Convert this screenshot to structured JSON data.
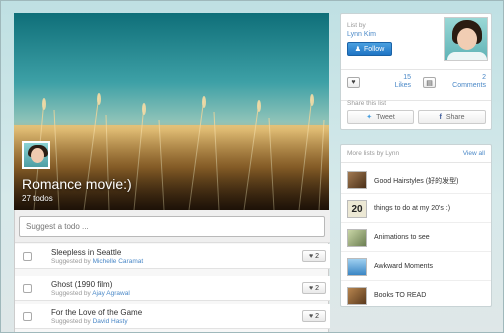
{
  "hero": {
    "title": "Romance movie:)",
    "count": "27 todos"
  },
  "suggest": {
    "placeholder": "Suggest a todo ..."
  },
  "todos": [
    {
      "title": "Sleepless in Seattle",
      "suggested_prefix": "Suggested by",
      "suggested_by": "Michelle Caramat",
      "likes": "2"
    },
    {
      "title": "Ghost (1990 film)",
      "suggested_prefix": "Suggested by",
      "suggested_by": "Ajay Agrawal",
      "likes": "2"
    },
    {
      "title": "For the Love of the Game",
      "suggested_prefix": "Suggested by",
      "suggested_by": "David Hasty",
      "likes": "2"
    }
  ],
  "list_card": {
    "by_label": "List by",
    "author": "Lynn Kim",
    "follow_label": "Follow",
    "likes_count": "15",
    "likes_label": "Likes",
    "comments_count": "2",
    "comments_label": "Comments",
    "share_label": "Share this list",
    "tweet_label": "Tweet",
    "share_btn_label": "Share"
  },
  "more_lists": {
    "title": "More lists by Lynn",
    "view_all": "View all",
    "items": [
      {
        "label": "Good Hairstyles (好的发型)",
        "thumb_color": "#6b4a2a"
      },
      {
        "label": "things to do at my 20's :)",
        "thumb_color": "#e9e5d2"
      },
      {
        "label": "Animations to see",
        "thumb_color": "#8fa27a"
      },
      {
        "label": "Awkward Moments",
        "thumb_color": "#5aa3d6"
      },
      {
        "label": "Books TO READ",
        "thumb_color": "#7a5532"
      }
    ]
  },
  "colors": {
    "link": "#4a88c7",
    "follow_button": "#1f74c4"
  }
}
